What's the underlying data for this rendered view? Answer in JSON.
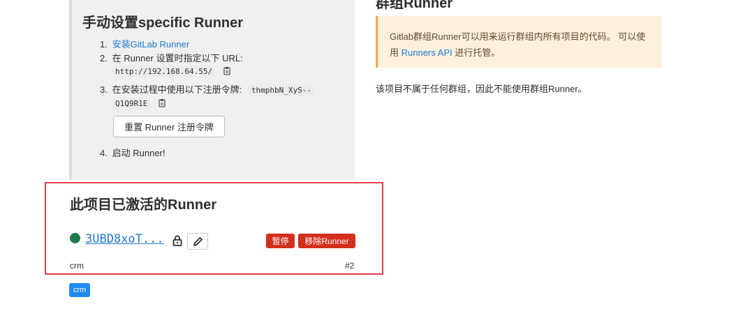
{
  "specific_runner": {
    "title": "手动设置specific Runner",
    "steps": [
      {
        "num": "1.",
        "link_text": "安装GitLab Runner"
      },
      {
        "num": "2.",
        "text": "在 Runner 设置时指定以下 URL:",
        "code": "http://192.168.64.55/"
      },
      {
        "num": "3.",
        "text": "在安装过程中使用以下注册令牌:",
        "code_part1": "thmphbN_XyS--",
        "code_part2": "Q1Q9R1E"
      },
      {
        "num": "4.",
        "text": "启动 Runner!"
      }
    ],
    "reset_button": "重置 Runner 注册令牌"
  },
  "group_runner": {
    "title": "群组Runner",
    "notice_before": "Gitlab群组Runner可以用来运行群组内所有项目的代码。 可以使用 ",
    "notice_link": "Runners API",
    "notice_after": " 进行托管。",
    "note": "该项目不属于任何群组，因此不能使用群组Runner。"
  },
  "active_runners": {
    "title": "此项目已激活的Runner",
    "runner": {
      "token": "3UBD8xoT...",
      "pause_label": "暂停",
      "remove_label": "移除Runner",
      "name": "crm",
      "id": "#2",
      "status_color": "#1f7a4a"
    },
    "tag": "crm"
  },
  "icons": [
    "copy-icon",
    "lock-icon",
    "pencil-icon"
  ],
  "colors": {
    "link": "#1f78d1",
    "danger": "#d22f1d",
    "highlight_border": "#e0434a",
    "tag": "#1f8bf0"
  }
}
